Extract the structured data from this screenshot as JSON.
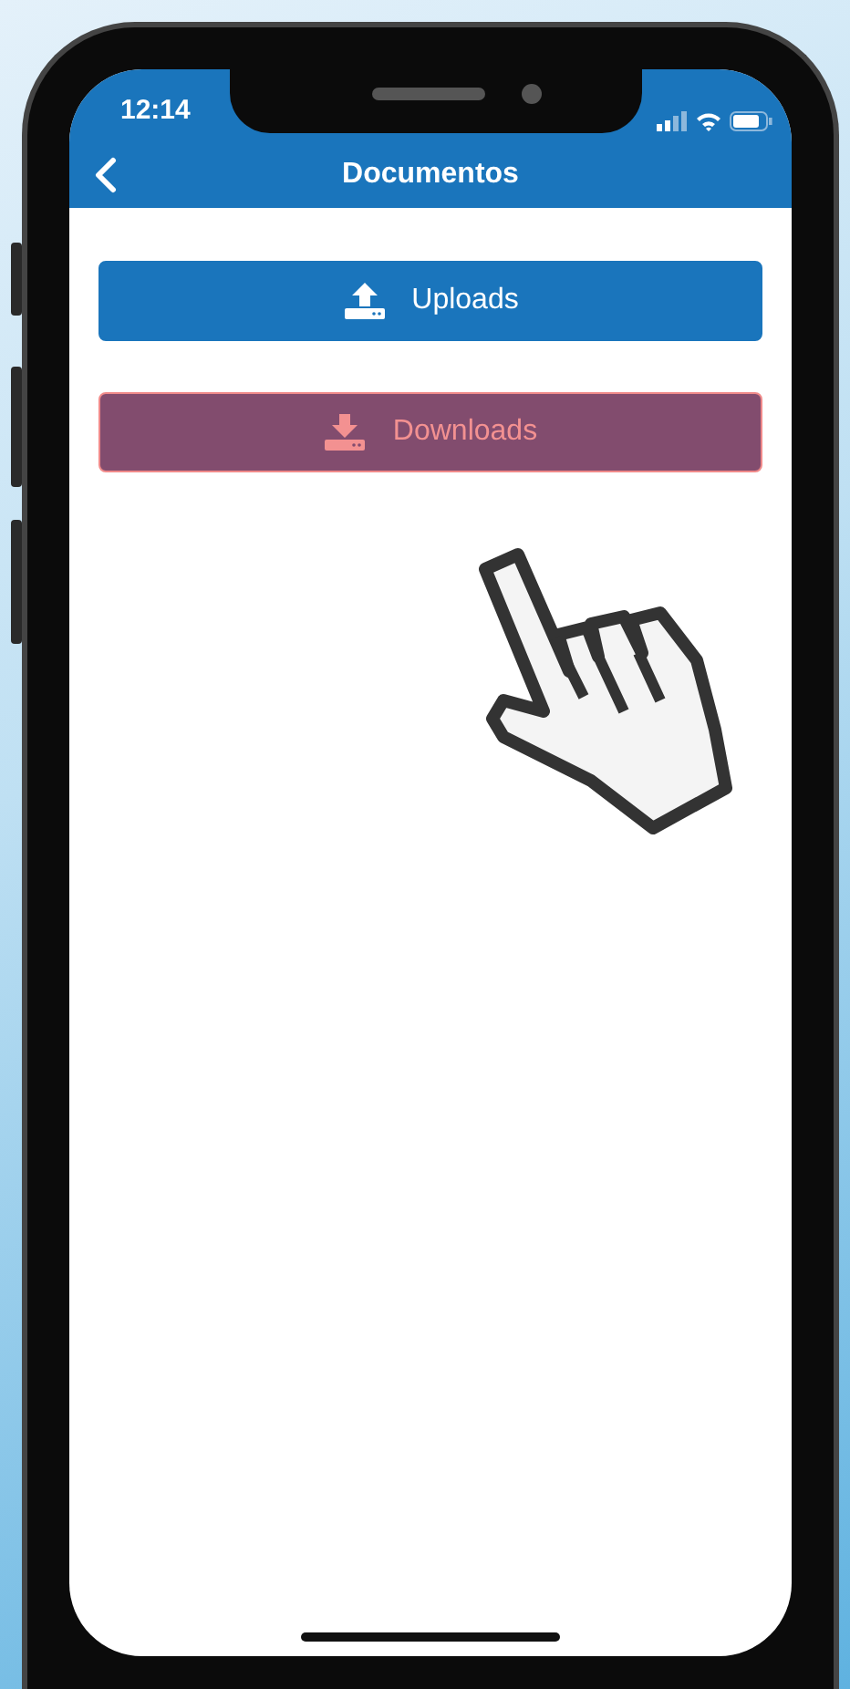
{
  "status_bar": {
    "time": "12:14"
  },
  "nav_bar": {
    "title": "Documentos"
  },
  "buttons": [
    {
      "label": "Uploads",
      "kind": "upload",
      "selected": false
    },
    {
      "label": "Downloads",
      "kind": "download",
      "selected": true
    }
  ]
}
